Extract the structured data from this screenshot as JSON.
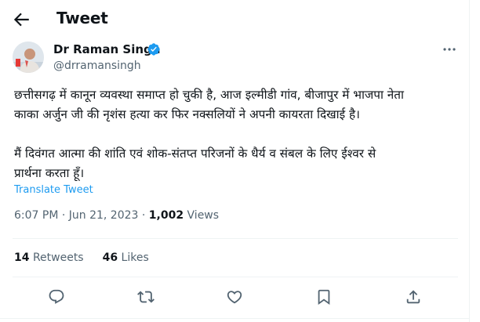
{
  "header": {
    "title": "Tweet"
  },
  "author": {
    "name": "Dr Raman Singh",
    "handle": "@drramansingh"
  },
  "tweet": {
    "text": "छत्तीसगढ़ में कानून व्यवस्था समाप्त हो चुकी है, आज इल्मीडी गांव, बीजापुर में भाजपा नेता\nकाका अर्जुन जी की नृशंस हत्या कर फिर नक्सलियों ने अपनी कायरता दिखाई है।\n\nमैं दिवंगत आत्मा की शांति एवं शोक-संतप्त परिजनों के धैर्य व संबल के लिए ईश्वर से\nप्रार्थना करता हूँ।",
    "translate_label": "Translate Tweet",
    "time": "6:07 PM · Jun 21, 2023 · ",
    "views_count": "1,002",
    "views_label": " Views"
  },
  "stats": {
    "retweets_count": "14",
    "retweets_label": "Retweets",
    "likes_count": "46",
    "likes_label": "Likes"
  },
  "icons": {
    "back": "arrow-left-icon",
    "verified": "verified-badge-icon",
    "more": "more-dots-icon",
    "reply": "reply-icon",
    "retweet": "retweet-icon",
    "like": "heart-icon",
    "bookmark": "bookmark-icon",
    "share": "share-icon"
  },
  "colors": {
    "accent": "#1d9bf0",
    "text": "#0f1419",
    "muted": "#536471",
    "divider": "#eff3f4"
  }
}
